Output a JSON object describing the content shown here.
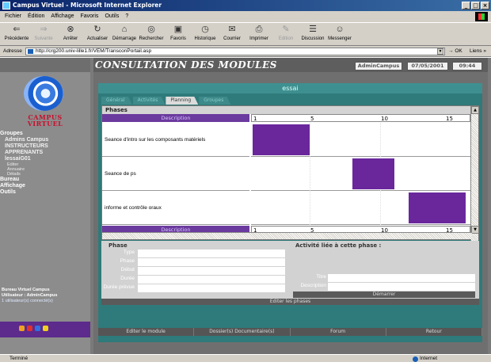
{
  "window": {
    "title": "Campus Virtuel - Microsoft Internet Explorer",
    "buttons": [
      "_",
      "□",
      "×"
    ]
  },
  "menu": [
    "Fichier",
    "Édition",
    "Affichage",
    "Favoris",
    "Outils",
    "?"
  ],
  "toolbar": [
    {
      "label": "Précédente",
      "icon": "back-icon",
      "glyph": "⇐",
      "disabled": false
    },
    {
      "label": "Suivante",
      "icon": "forward-icon",
      "glyph": "⇒",
      "disabled": true
    },
    {
      "label": "Arrêter",
      "icon": "stop-icon",
      "glyph": "⊗",
      "disabled": false
    },
    {
      "label": "Actualiser",
      "icon": "refresh-icon",
      "glyph": "↻",
      "disabled": false
    },
    {
      "label": "Démarrage",
      "icon": "home-icon",
      "glyph": "⌂",
      "disabled": false
    },
    {
      "label": "Rechercher",
      "icon": "search-icon",
      "glyph": "◎",
      "disabled": false
    },
    {
      "label": "Favoris",
      "icon": "favorites-icon",
      "glyph": "▣",
      "disabled": false
    },
    {
      "label": "Historique",
      "icon": "history-icon",
      "glyph": "◷",
      "disabled": false
    },
    {
      "label": "Courrier",
      "icon": "mail-icon",
      "glyph": "✉",
      "disabled": false
    },
    {
      "label": "Imprimer",
      "icon": "print-icon",
      "glyph": "⎙",
      "disabled": false
    },
    {
      "label": "Edition",
      "icon": "edit-icon",
      "glyph": "✎",
      "disabled": true
    },
    {
      "label": "Discussion",
      "icon": "discussion-icon",
      "glyph": "☰",
      "disabled": false
    },
    {
      "label": "Messenger",
      "icon": "messenger-icon",
      "glyph": "☺",
      "disabled": false
    }
  ],
  "address": {
    "label": "Adresse",
    "url": "http://crg200.univ-lille1.fr/VEM/TransconPortail.asp",
    "go": "OK",
    "links": "Liens »"
  },
  "sidebar": {
    "brand_line1": "CAMPUS",
    "brand_line2": "VIRTUEL",
    "nav": [
      {
        "text": "Groupes",
        "level": 0
      },
      {
        "text": "Admins Campus",
        "level": 1
      },
      {
        "text": "INSTRUCTEURS",
        "level": 1
      },
      {
        "text": "APPRENANTS",
        "level": 1
      },
      {
        "text": "lessaiG01",
        "level": 1
      },
      {
        "text": "Editer",
        "level": 2
      },
      {
        "text": "Annuaire",
        "level": 2
      },
      {
        "text": "Détails",
        "level": 2
      },
      {
        "text": "Bureau",
        "level": 0
      },
      {
        "text": "Affichage",
        "level": 0
      },
      {
        "text": "Outils",
        "level": 0
      }
    ],
    "status_title": "Bureau Virtuel Campus",
    "status_user": "Utilisateur : AdminCampus",
    "status_connected": "1 utilisateur(s) connecté(s)",
    "icon_colors": [
      "#f0a020",
      "#e03030",
      "#3070e0",
      "#f0d020"
    ]
  },
  "header": {
    "title": "CONSULTATION DES MODULES",
    "user": "AdminCampus",
    "date": "07/05/2001",
    "time": "09:44"
  },
  "module": {
    "name": "essai",
    "tabs": [
      "Général",
      "Activités",
      "Planning",
      "Groupes"
    ],
    "active_tab": "Planning",
    "phases_label": "Phases",
    "description_header": "Description",
    "scale": [
      "1",
      "5",
      "10",
      "15"
    ],
    "scale_max": 16,
    "phases": [
      {
        "description": "Seance d'intro sur les composants matériels",
        "start": 1,
        "end": 5
      },
      {
        "description": "Seance de ps",
        "start": 8,
        "end": 11
      },
      {
        "description": "informe et contrôle oraux",
        "start": 12,
        "end": 16
      }
    ],
    "bar_color": "#6a279c"
  },
  "phase_detail": {
    "title": "Phase",
    "fields": [
      "Type",
      "Phase",
      "Début",
      "Durée",
      "Durée prévue"
    ],
    "activity_title": "Activité liée à cette phase :",
    "activity_fields": [
      "Titre",
      "Description"
    ],
    "start_button": "Démarrer",
    "edit_phases_button": "Editer les phases"
  },
  "footer_buttons": [
    "Editer le module",
    "Dossier(s) Documentaire(s)",
    "Forum",
    "Retour"
  ],
  "status": {
    "left": "Terminé",
    "right": "Internet"
  }
}
